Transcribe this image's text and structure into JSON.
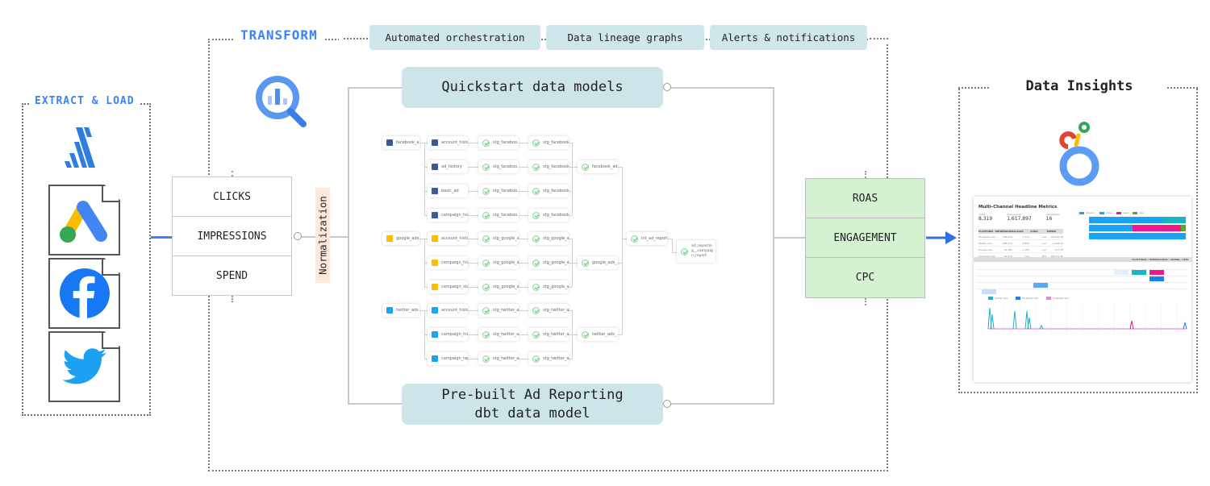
{
  "extract_load": {
    "title": "EXTRACT & LOAD",
    "connector_icon": "fivetran-icon",
    "sources": [
      {
        "name": "Google Ads",
        "icon": "google-ads-icon"
      },
      {
        "name": "Facebook",
        "icon": "facebook-icon"
      },
      {
        "name": "Twitter",
        "icon": "twitter-icon"
      }
    ]
  },
  "metrics_in": [
    "CLICKS",
    "IMPRESSIONS",
    "SPEND"
  ],
  "normalization_label": "Normalization",
  "transform": {
    "title": "TRANSFORM",
    "warehouse_icon": "bigquery-icon",
    "features": [
      "Automated orchestration",
      "Data lineage graphs",
      "Alerts & notifications"
    ],
    "quickstart_label": "Quickstart data models",
    "prebuilt_label_line1": "Pre-built Ad Reporting",
    "prebuilt_label_line2": "dbt data model"
  },
  "lineage": {
    "groups": [
      {
        "source": "facebook_a...",
        "icon": "facebook",
        "rows": [
          {
            "base": "account_histo...",
            "stg1": "stg_faceboo...",
            "stg2": "stg_facebook..."
          },
          {
            "base": "ad_history",
            "stg1": "stg_faceboo...",
            "stg2": "stg_facebook..."
          },
          {
            "base": "basic_ad",
            "stg1": "stg_faceboo...",
            "stg2": "stg_facebook..."
          },
          {
            "base": "campaign_his...",
            "stg1": "stg_faceboo...",
            "stg2": "stg_facebook..."
          }
        ],
        "model": "facebook_ads..."
      },
      {
        "source": "google_ads",
        "icon": "google",
        "rows": [
          {
            "base": "account_histo...",
            "stg1": "stg_google_a...",
            "stg2": "stg_google_a..."
          },
          {
            "base": "campaign_his...",
            "stg1": "stg_google_a...",
            "stg2": "stg_google_a..."
          },
          {
            "base": "campaign_sta...",
            "stg1": "stg_google_a...",
            "stg2": "stg_google_a..."
          }
        ],
        "model": "google_ads_..."
      },
      {
        "source": "twitter_ads",
        "icon": "twitter",
        "rows": [
          {
            "base": "account_histo...",
            "stg1": "stg_twitter_a...",
            "stg2": "stg_twitter_a..."
          },
          {
            "base": "campaign_his...",
            "stg1": "stg_twitter_a...",
            "stg2": "stg_twitter_a..."
          },
          {
            "base": "campaign_rep...",
            "stg1": "stg_twitter_a...",
            "stg2": "stg_twitter_a..."
          }
        ],
        "model": "twitter_ads_..."
      }
    ],
    "intermediate": "int_ad_reporti...",
    "final": "ad_reportin g__campaig n_report"
  },
  "metrics_out": [
    "ROAS",
    "ENGAGEMENT",
    "CPC"
  ],
  "insights": {
    "title": "Data Insights",
    "logo_icon": "looker-icon",
    "dashboard": {
      "title": "Multi-Channel Headline Metrics",
      "kpis": [
        {
          "label": "Clicks",
          "value": "8,319"
        },
        {
          "label": "Impressions",
          "value": "1,617,897"
        },
        {
          "label": "Campaigns",
          "value": "16"
        }
      ],
      "table_headers": [
        "PLATFORM",
        "IMPRESSIONS",
        "CLICKS",
        "CONV",
        "SPEND"
      ],
      "table_rows": [
        [
          "Facebook Ads",
          "796,614",
          "1,710",
          "null",
          "24,238.48"
        ],
        [
          "Twitter Ads",
          "436,013",
          "1,893",
          "null",
          "2,108.40"
        ],
        [
          "Google Ads",
          "10,482",
          "1,165",
          "null",
          "247.18"
        ],
        [
          "Snapchat Ads",
          "10,474",
          "null",
          "783",
          "68,731.10"
        ]
      ],
      "bar_legend": [
        {
          "name": "Organic",
          "color": "#1aa3f5"
        },
        {
          "name": "Video",
          "color": "#17b3c7"
        },
        {
          "name": "Lead",
          "color": "#f0168d"
        },
        {
          "name": "App",
          "color": "#5aa821"
        }
      ],
      "pivot_label": "PLATFORM / IMPRESSIONS / SPEND / CPM",
      "line_legend": [
        "twitter ads",
        "facebook ads",
        "pinterest ads"
      ]
    }
  },
  "colors": {
    "accent_blue": "#3b82f6",
    "model_box": "#cde5e9",
    "output_green": "#d5f2d3",
    "normalization_bg": "#fde8dc"
  }
}
